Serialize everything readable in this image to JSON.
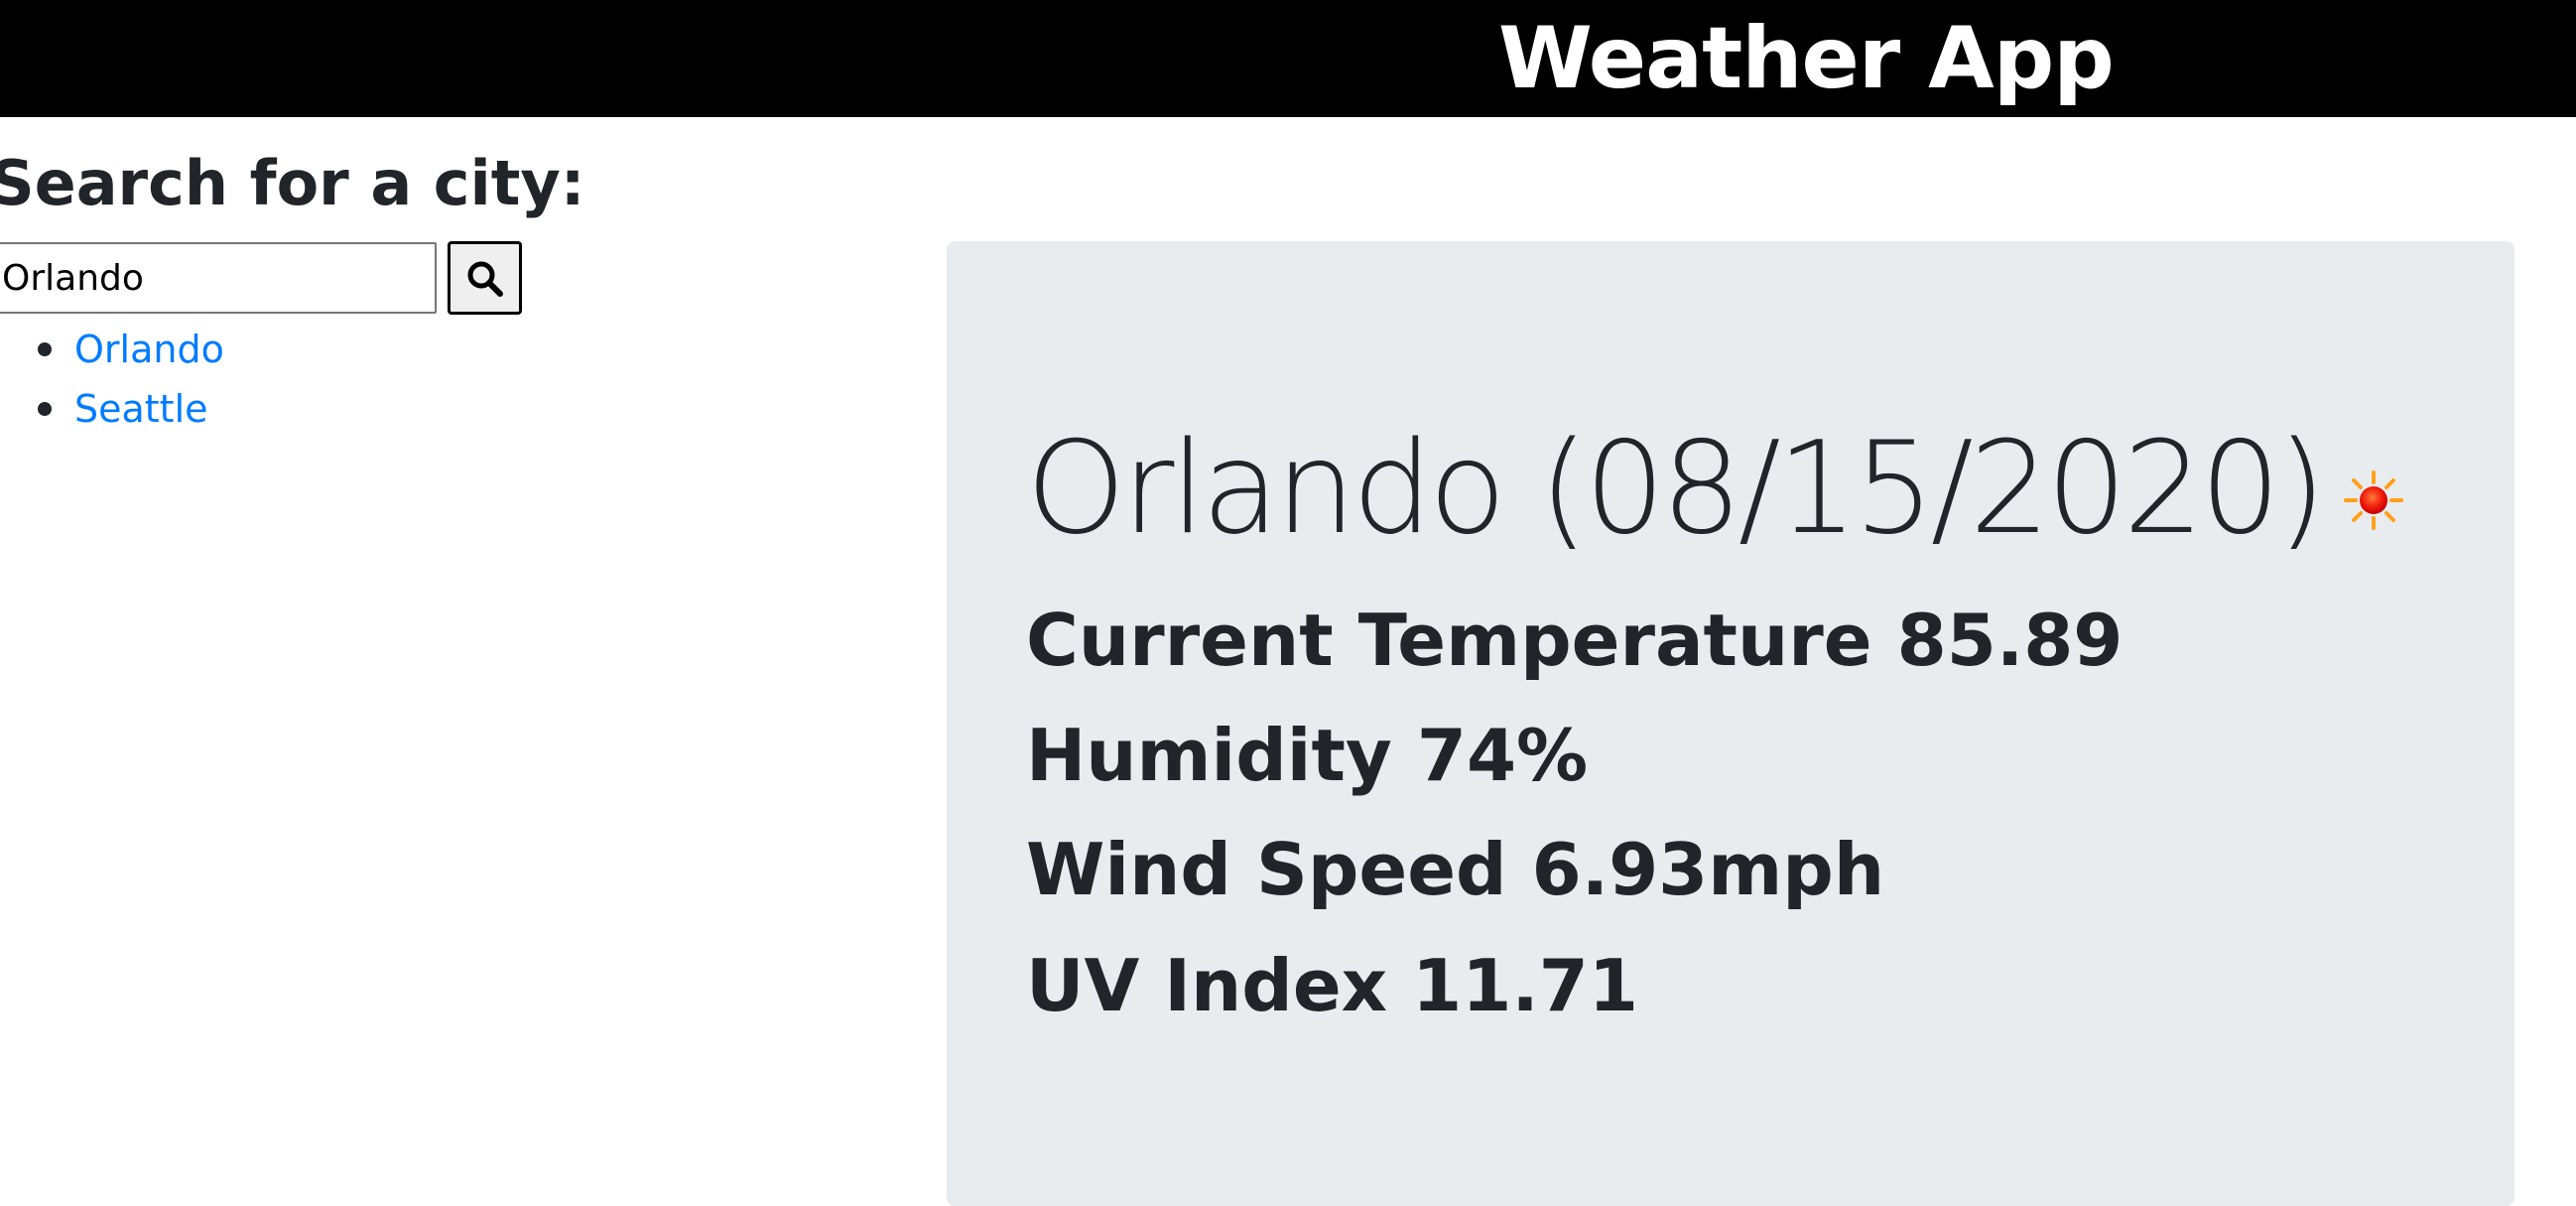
{
  "header": {
    "title": "Weather App"
  },
  "search": {
    "heading": "Search for a city:",
    "input_value": "Orlando",
    "button_icon": "search-icon"
  },
  "history": {
    "items": [
      {
        "label": "Orlando"
      },
      {
        "label": "Seattle"
      }
    ]
  },
  "current": {
    "city_date": "Orlando (08/15/2020)",
    "icon": "sun-icon",
    "temperature": "Current Temperature 85.89",
    "humidity": "Humidity 74%",
    "wind_speed": "Wind Speed 6.93mph",
    "uv_index": "UV Index 11.71"
  },
  "colors": {
    "header_bg": "#000000",
    "header_text": "#ffffff",
    "link": "#007bff",
    "card_bg": "#e9ecef",
    "text": "#212529"
  }
}
